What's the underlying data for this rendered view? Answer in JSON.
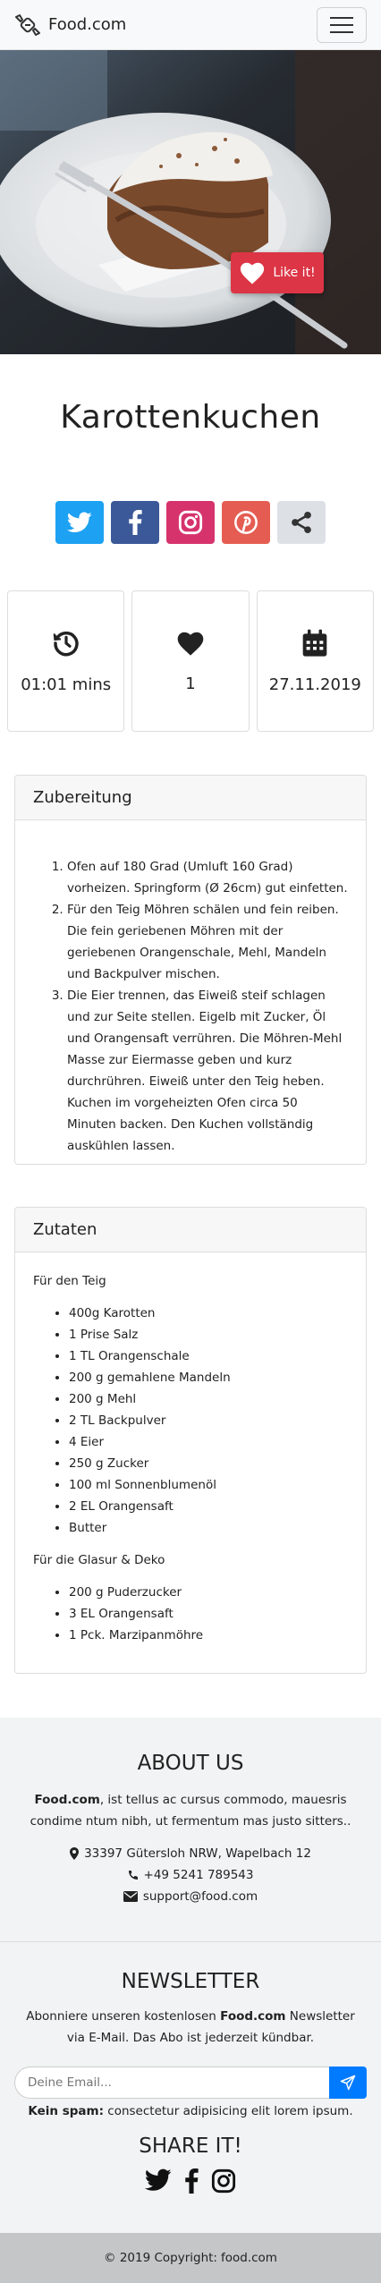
{
  "brand": {
    "name": "Food.com",
    "icon": "candy-icon"
  },
  "hero": {
    "like_label": "Like it!"
  },
  "recipe": {
    "title": "Karottenkuchen"
  },
  "share_buttons": [
    {
      "icon": "twitter-icon",
      "color": "#1da1f2"
    },
    {
      "icon": "facebook-icon",
      "color": "#3b5998"
    },
    {
      "icon": "instagram-icon",
      "color": "#d6336c"
    },
    {
      "icon": "pinterest-icon",
      "color": "#e55d52"
    },
    {
      "icon": "share-icon",
      "color": "#dde1e6"
    }
  ],
  "stats": {
    "time": "01:01 mins",
    "likes": "1",
    "date": "27.11.2019"
  },
  "preparation": {
    "header": "Zubereitung",
    "steps": [
      "Ofen auf 180 Grad (Umluft 160 Grad) vorheizen. Springform (Ø 26cm) gut einfetten.",
      "Für den Teig Möhren schälen und fein reiben. Die fein geriebenen Möhren mit der geriebenen Orangenschale, Mehl, Mandeln und Backpulver mischen.",
      "Die Eier trennen, das Eiweiß steif schlagen und zur Seite stellen. Eigelb mit Zucker, Öl und Orangensaft verrühren. Die Möhren-Mehl Masse zur Eiermasse geben und kurz durchrühren. Eiweiß unter den Teig heben. Kuchen im vorgeheizten Ofen circa 50 Minuten backen. Den Kuchen vollständig auskühlen lassen."
    ]
  },
  "ingredients": {
    "header": "Zutaten",
    "groups": [
      {
        "title": "Für den Teig",
        "items": [
          "400g Karotten",
          "1 Prise Salz",
          "1 TL Orangenschale",
          "200 g gemahlene Mandeln",
          "200 g Mehl",
          "2 TL Backpulver",
          "4 Eier",
          "250 g Zucker",
          "100 ml Sonnenblumenöl",
          "2 EL Orangensaft",
          "Butter"
        ]
      },
      {
        "title": "Für die Glasur & Deko",
        "items": [
          "200 g Puderzucker",
          "3 EL Orangensaft",
          "1 Pck. Marzipanmöhre"
        ]
      }
    ]
  },
  "footer": {
    "about_title": "ABOUT US",
    "about_brand": "Food.com",
    "about_text": ", ist tellus ac cursus commodo, mauesris condime ntum nibh, ut fermentum mas justo sitters..",
    "address": "33397 Gütersloh NRW, Wapelbach 12",
    "phone": "+49 5241 789543",
    "email": "support@food.com",
    "newsletter_title": "NEWSLETTER",
    "newsletter_pre": "Abonniere unseren kostenlosen ",
    "newsletter_brand": "Food.com",
    "newsletter_post": " Newsletter via E-Mail. Das Abo ist jederzeit kündbar.",
    "email_placeholder": "Deine Email...",
    "spam_bold": "Kein spam:",
    "spam_text": " consectetur adipisicing elit lorem ipsum.",
    "share_title": "SHARE IT!",
    "copyright_pre": "© 2019 Copyright:",
    "copyright_brand": "food.com"
  },
  "colors": {
    "like": "#dc3545",
    "send": "#007bff"
  }
}
